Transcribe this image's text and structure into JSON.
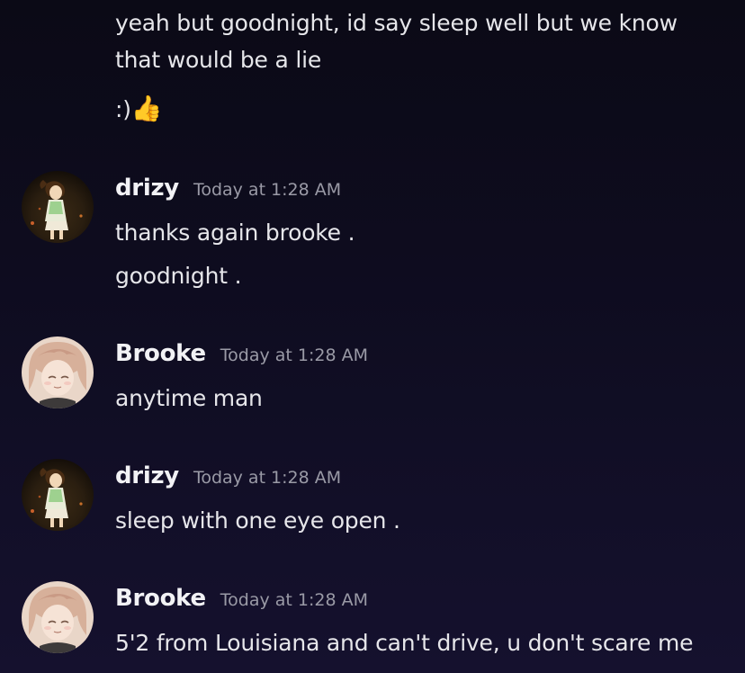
{
  "messages": {
    "first_group": {
      "line1": "yeah but goodnight, id say sleep well but we know",
      "line2": "that would be a lie",
      "line3_text": ":)",
      "line3_emoji": "👍"
    },
    "group1": {
      "author": "drizy",
      "timestamp": "Today at 1:28 AM",
      "lines": [
        "thanks again brooke .",
        "goodnight ."
      ]
    },
    "group2": {
      "author": "Brooke",
      "timestamp": "Today at 1:28 AM",
      "lines": [
        "anytime man"
      ]
    },
    "group3": {
      "author": "drizy",
      "timestamp": "Today at 1:28 AM",
      "lines": [
        "sleep with one eye open ."
      ]
    },
    "group4": {
      "author": "Brooke",
      "timestamp": "Today at 1:28 AM",
      "lines": [
        "5'2 from Louisiana and can't drive, u don't scare me"
      ]
    }
  },
  "icons": {
    "emoji": "thumbs-up-icon",
    "drizy_avatar": "anime-girl-dark-avatar",
    "brooke_avatar": "anime-boy-pink-avatar"
  }
}
